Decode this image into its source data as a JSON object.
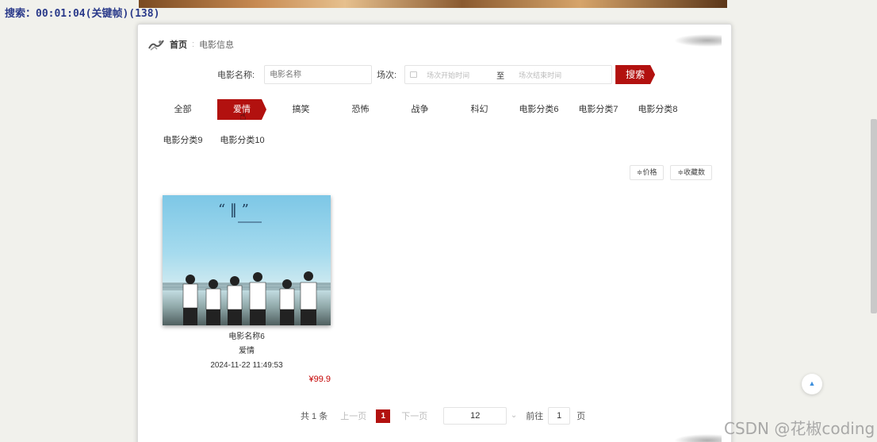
{
  "overlay": {
    "text": "搜索：00:01:04(关键帧)(138)"
  },
  "breadcrumb": {
    "home": "首页",
    "separator": ":",
    "current": "电影信息"
  },
  "search": {
    "name_label": "电影名称:",
    "name_placeholder": "电影名称",
    "session_label": "场次:",
    "start_placeholder": "场次开始时间",
    "to_label": "至",
    "end_placeholder": "场次结束时间",
    "search_button": "搜索"
  },
  "categories": {
    "row1": [
      "全部",
      "爱情",
      "搞笑",
      "恐怖",
      "战争",
      "科幻",
      "电影分类6",
      "电影分类7",
      "电影分类8"
    ],
    "row2": [
      "电影分类9",
      "电影分类10"
    ],
    "active": "爱情"
  },
  "sort": {
    "price": "≑价格",
    "favorites": "≑收藏数"
  },
  "movies": [
    {
      "name": "电影名称6",
      "category": "爱情",
      "time": "2024-11-22 11:49:53",
      "price": "¥99.9"
    }
  ],
  "pagination": {
    "total": "共 1 条",
    "prev": "上一页",
    "current_page": "1",
    "next": "下一页",
    "page_size": "12",
    "goto_label": "前往",
    "goto_value": "1",
    "page_suffix": "页"
  },
  "watermark": "CSDN @花椒coding",
  "colors": {
    "accent": "#b2110f",
    "price": "#c40000",
    "back_top_icon": "#3d8fdc"
  },
  "icons": {
    "calendar": "calendar-icon",
    "back_to_top": "up-triangle-icon",
    "sort": "sort-icon"
  }
}
